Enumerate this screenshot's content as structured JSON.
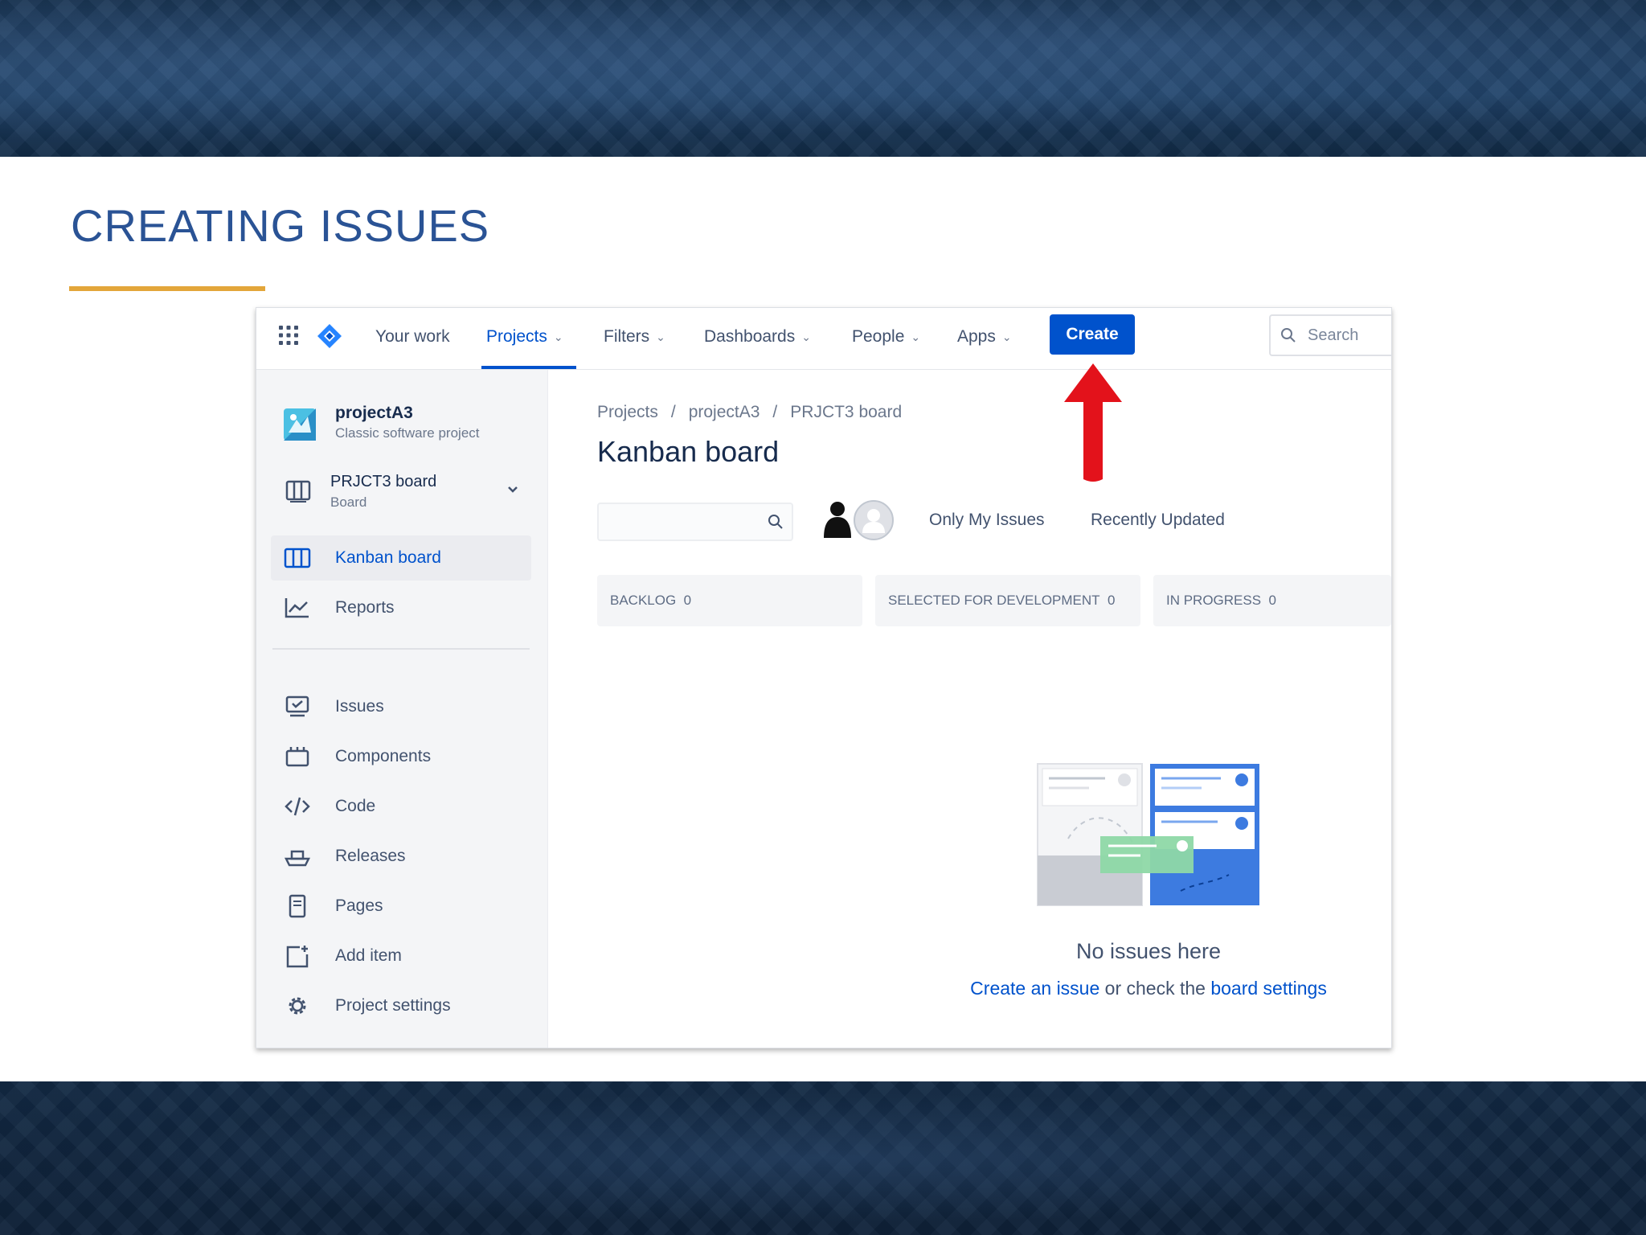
{
  "slide": {
    "title": "CREATING ISSUES",
    "colors": {
      "title": "#2a5395",
      "underline": "#e3a63a",
      "annotation_arrow": "#e3121b"
    }
  },
  "topnav": {
    "app_switcher_icon": "grid-icon",
    "logo_icon": "jira-diamond-logo-icon",
    "items": [
      {
        "label": "Your work",
        "dropdown": false
      },
      {
        "label": "Projects",
        "dropdown": true,
        "active": true
      },
      {
        "label": "Filters",
        "dropdown": true
      },
      {
        "label": "Dashboards",
        "dropdown": true
      },
      {
        "label": "People",
        "dropdown": true
      },
      {
        "label": "Apps",
        "dropdown": true
      }
    ],
    "create_label": "Create",
    "search_placeholder": "Search",
    "accent": "#0052cc"
  },
  "sidebar": {
    "project": {
      "name": "projectA3",
      "type": "Classic software project"
    },
    "board_selector": {
      "name": "PRJCT3 board",
      "sub": "Board"
    },
    "items": [
      {
        "label": "Kanban board",
        "icon": "board-icon",
        "selected": true
      },
      {
        "label": "Reports",
        "icon": "chart-line-icon"
      },
      {
        "label": "Issues",
        "icon": "issues-icon"
      },
      {
        "label": "Components",
        "icon": "component-icon"
      },
      {
        "label": "Code",
        "icon": "code-icon"
      },
      {
        "label": "Releases",
        "icon": "ship-icon"
      },
      {
        "label": "Pages",
        "icon": "page-icon"
      },
      {
        "label": "Add item",
        "icon": "add-item-icon"
      },
      {
        "label": "Project settings",
        "icon": "gear-icon"
      }
    ]
  },
  "main": {
    "breadcrumbs": [
      "Projects",
      "projectA3",
      "PRJCT3 board"
    ],
    "title": "Kanban board",
    "quick_filters": [
      "Only My Issues",
      "Recently Updated"
    ],
    "columns": [
      {
        "name": "BACKLOG",
        "count": "0"
      },
      {
        "name": "SELECTED FOR DEVELOPMENT",
        "count": "0"
      },
      {
        "name": "IN PROGRESS",
        "count": "0"
      }
    ],
    "empty_state": {
      "title": "No issues here",
      "create_link": "Create an issue",
      "middle_text": " or check the ",
      "settings_link": "board settings"
    }
  }
}
